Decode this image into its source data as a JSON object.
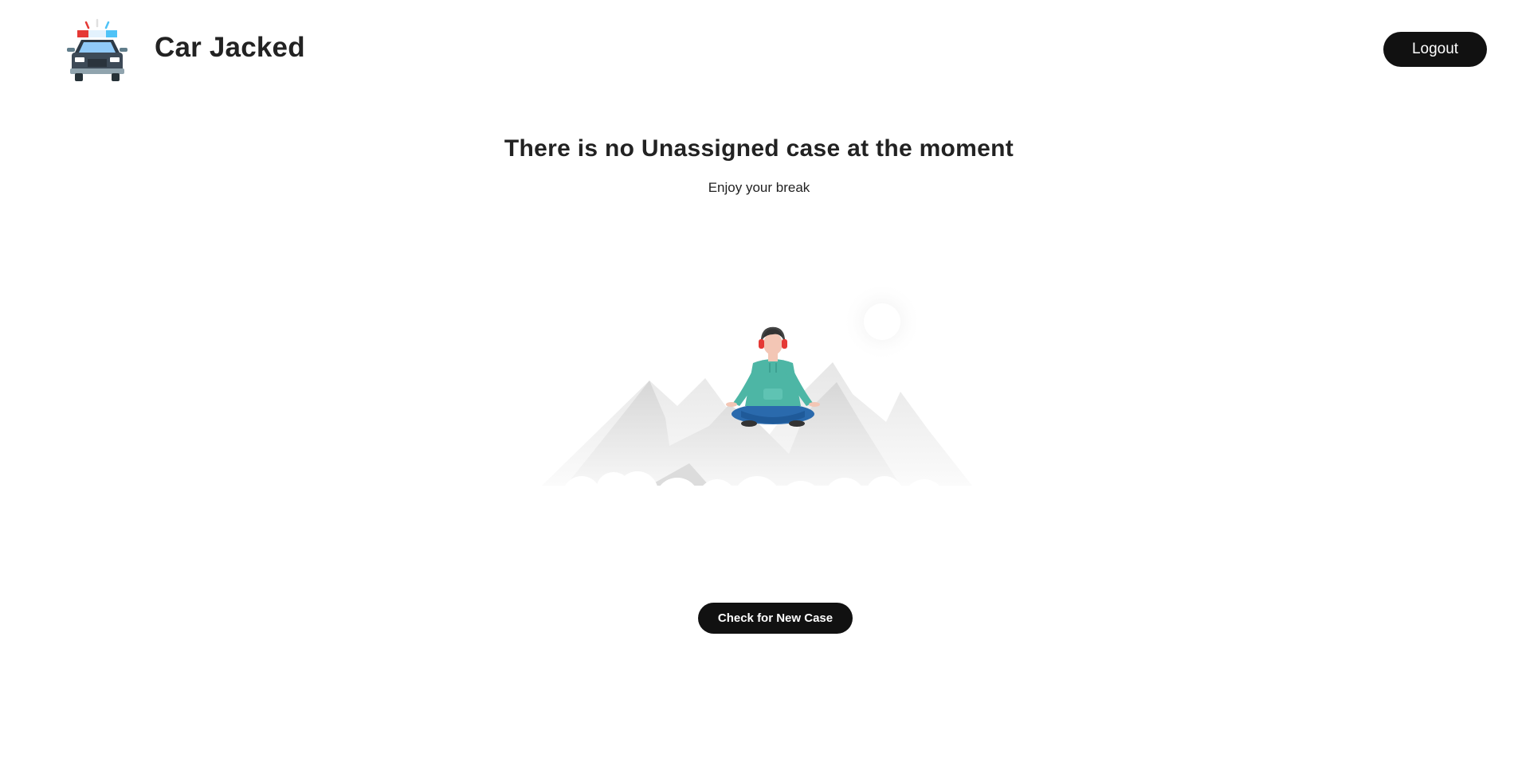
{
  "header": {
    "brand_title": "Car Jacked",
    "logo_icon": "police-car-icon",
    "logout_label": "Logout"
  },
  "main": {
    "headline": "There is no Unassigned case at the moment",
    "subline": "Enjoy your break",
    "illustration_icon": "meditating-person-on-mountains-illustration",
    "check_button_label": "Check for New Case"
  },
  "colors": {
    "button_bg": "#111111",
    "button_text": "#ffffff",
    "text": "#222222",
    "hoodie": "#4db6a5",
    "jeans": "#2a6aad"
  }
}
